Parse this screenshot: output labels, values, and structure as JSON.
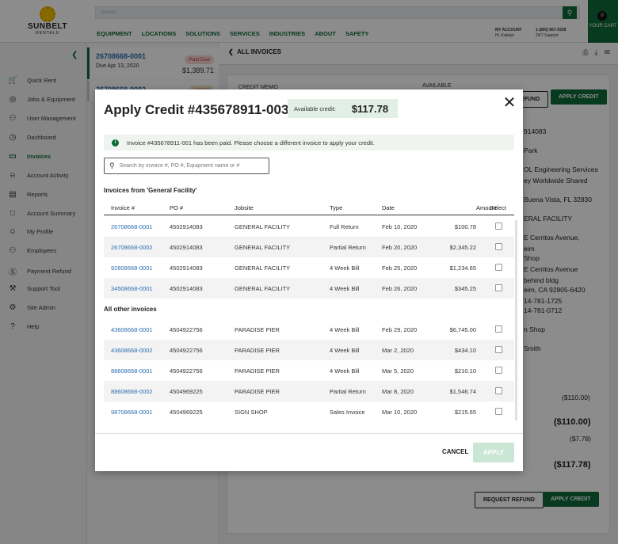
{
  "header": {
    "logo_name": "SUNBELT",
    "logo_sub": "RENTALS",
    "search_placeholder": "Search",
    "nav": [
      "EQUIPMENT",
      "LOCATIONS",
      "SOLUTIONS",
      "SERVICES",
      "INDUSTRIES",
      "ABOUT",
      "SAFETY"
    ],
    "account_label": "MY ACCOUNT",
    "account_name": "Hi, Katelyn",
    "phone": "1 (800) 667-9328",
    "support": "24/7 Support",
    "cart_label": "YOUR CART",
    "cart_count": "0"
  },
  "sidebar": {
    "items": [
      {
        "label": "Quick Rent",
        "icon": "cart-icon"
      },
      {
        "label": "Jobs & Equipment",
        "icon": "location-icon"
      },
      {
        "label": "User Management",
        "icon": "users-icon"
      },
      {
        "label": "Dashboard",
        "icon": "dashboard-icon"
      },
      {
        "label": "Invoices",
        "icon": "card-icon"
      },
      {
        "label": "Account Activity",
        "icon": "bell-icon"
      },
      {
        "label": "Reports",
        "icon": "chart-icon"
      },
      {
        "label": "Account Summary",
        "icon": "book-icon"
      },
      {
        "label": "My Profile",
        "icon": "person-icon"
      },
      {
        "label": "Employees",
        "icon": "employees-icon"
      },
      {
        "label": "Payment Refund",
        "icon": "refund-icon"
      },
      {
        "label": "Support Tool",
        "icon": "wrench-icon"
      },
      {
        "label": "Site Admin",
        "icon": "gear-icon"
      },
      {
        "label": "Help",
        "icon": "help-icon"
      }
    ]
  },
  "invoice_list": [
    {
      "number": "26708668-0001",
      "due": "Due Apr 13, 2020",
      "amount": "$1,389.71",
      "status": "Past Due"
    },
    {
      "number": "26708668-0002",
      "due": "",
      "amount": "",
      "status": "Unpaid"
    }
  ],
  "main": {
    "back_label": "ALL INVOICES",
    "credit_memo_label": "CREDIT MEMO",
    "available_label": "AVAILABLE",
    "refund_btn": "REFUND",
    "apply_credit_btn": "APPLY CREDIT",
    "detail_lines": [
      "914083",
      "Park",
      "OL Engineering Services",
      "ey Worldwide Shared",
      "Buena Vista, FL 32830",
      "ERAL FACILITY",
      "E Cerritos Avenue,",
      "eim",
      "Shop",
      "E Cerritos Avenue",
      "behind bldg",
      "eim, CA 92805-6420",
      "14-781-1725",
      "14-781-0712",
      "n Shop",
      "Smith"
    ],
    "totals": [
      "($110.00)",
      "($110.00)",
      "($7.78)",
      "($117.78)"
    ],
    "request_refund_btn": "REQUEST REFUND",
    "apply_credit_btn2": "APPLY CREDIT"
  },
  "modal": {
    "title": "Apply Credit #435678911-003",
    "available_label": "Available credit:",
    "available_value": "$117.78",
    "notice": "Invoice #435678911-001 has been paid. Please choose a different invoice to apply your credit.",
    "search_placeholder": "Search by invoice #, PO #, Equipment name or #",
    "section1": "Invoices from 'General Facility'",
    "section2": "All other invoices",
    "columns": [
      "Invoice #",
      "PO #",
      "Jobsite",
      "Type",
      "Date",
      "Amount",
      "Select"
    ],
    "rows_general": [
      {
        "inv": "26708668-0001",
        "po": "4502914083",
        "jobsite": "GENERAL FACILITY",
        "type": "Full Return",
        "date": "Feb 10, 2020",
        "amount": "$100.78"
      },
      {
        "inv": "26708668-0002",
        "po": "4502914083",
        "jobsite": "GENERAL FACILITY",
        "type": "Partial Return",
        "date": "Feb 20, 2020",
        "amount": "$2,345.22"
      },
      {
        "inv": "92608668-0001",
        "po": "4502914083",
        "jobsite": "GENERAL FACILITY",
        "type": "4 Week Bill",
        "date": "Feb 25, 2020",
        "amount": "$1,234.65"
      },
      {
        "inv": "34508668-0001",
        "po": "4502914083",
        "jobsite": "GENERAL FACILITY",
        "type": "4 Week Bill",
        "date": "Feb 26, 2020",
        "amount": "$345.25"
      }
    ],
    "rows_other": [
      {
        "inv": "43608668-0001",
        "po": "4504922756",
        "jobsite": "PARADISE PIER",
        "type": "4 Week Bill",
        "date": "Feb 29, 2020",
        "amount": "$6,745.00"
      },
      {
        "inv": "43608668-0002",
        "po": "4504922756",
        "jobsite": "PARADISE PIER",
        "type": "4 Week Bill",
        "date": "Mar 2, 2020",
        "amount": "$434.10"
      },
      {
        "inv": "88608668-0001",
        "po": "4504922756",
        "jobsite": "PARADISE PIER",
        "type": "4 Week Bill",
        "date": "Mar 5, 2020",
        "amount": "$210.10"
      },
      {
        "inv": "88608668-0002",
        "po": "4504969225",
        "jobsite": "PARADISE PIER",
        "type": "Partial Return",
        "date": "Mar 8, 2020",
        "amount": "$1,546.74"
      },
      {
        "inv": "98708668-0001",
        "po": "4504969225",
        "jobsite": "SIGN SHOP",
        "type": "Sales Invoice",
        "date": "Mar 10, 2020",
        "amount": "$215.65"
      }
    ],
    "cancel": "CANCEL",
    "apply": "APPLY"
  }
}
